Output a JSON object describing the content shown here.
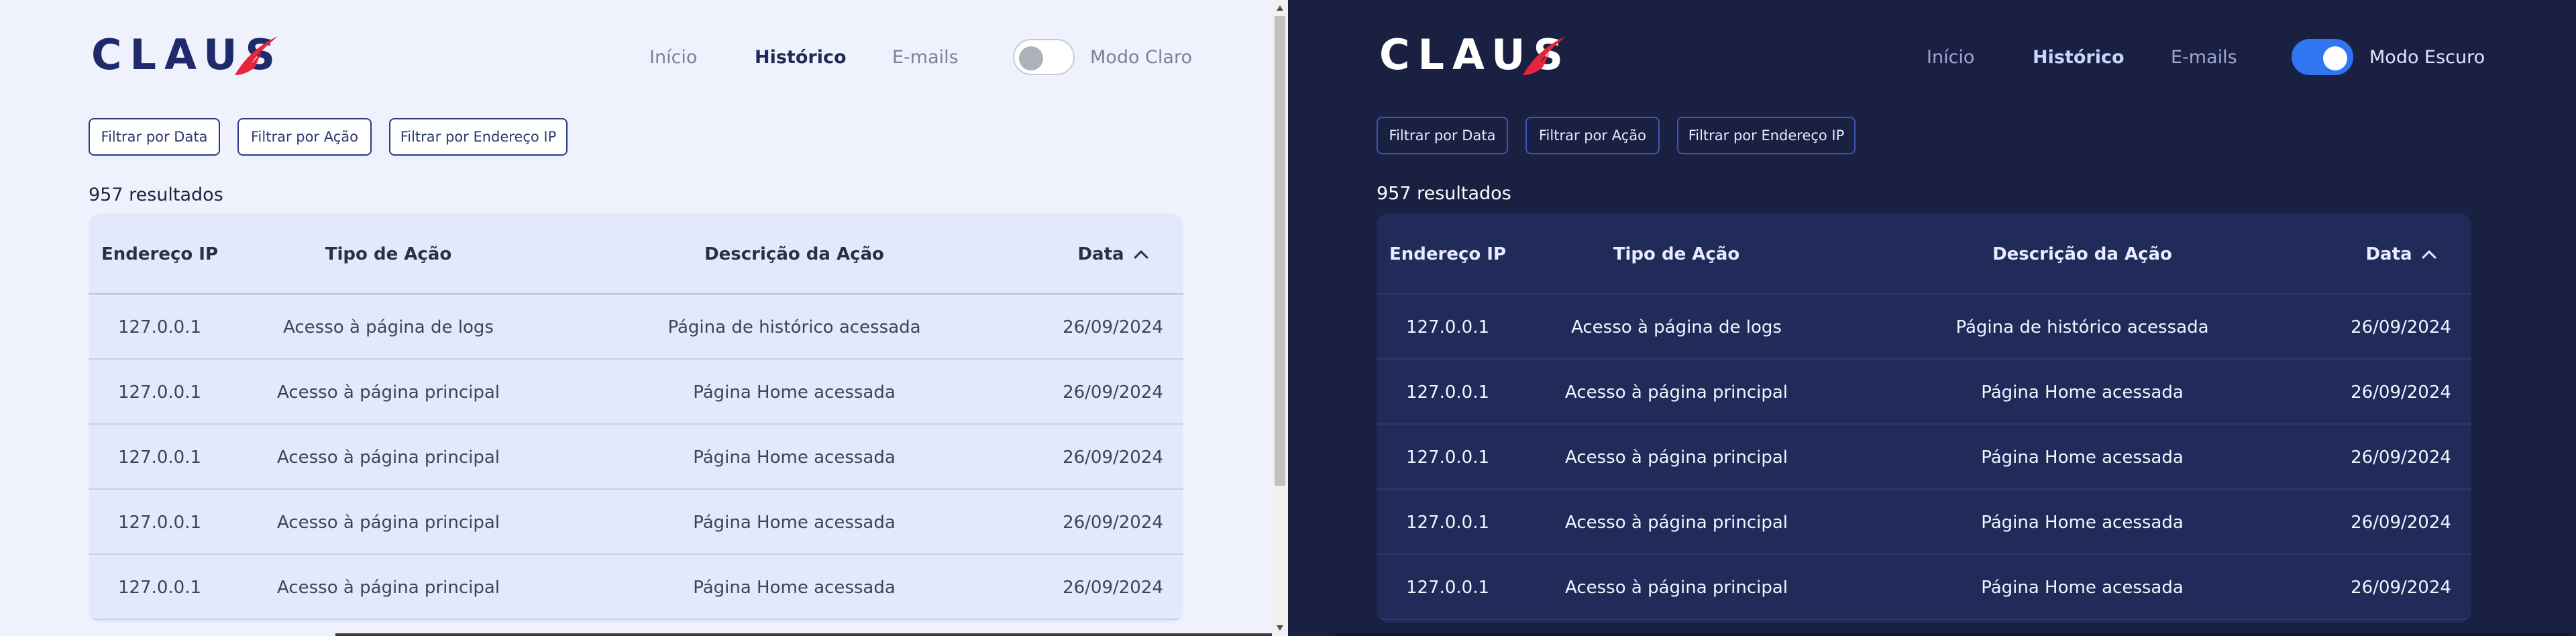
{
  "brand": {
    "logo_text": "CLAUS"
  },
  "nav": {
    "inicio": "Início",
    "historico": "Histórico",
    "emails": "E-mails"
  },
  "light": {
    "mode_label": "Modo Claro"
  },
  "dark": {
    "mode_label": "Modo Escuro"
  },
  "filters": {
    "by_date": "Filtrar por Data",
    "by_action": "Filtrar por Ação",
    "by_ip": "Filtrar por Endereço IP"
  },
  "results_count": "957 resultados",
  "table": {
    "headers": {
      "ip": "Endereço IP",
      "tipo": "Tipo de Ação",
      "desc": "Descrição da Ação",
      "data": "Data"
    },
    "sort": {
      "column": "Data",
      "direction": "ascending"
    },
    "rows": [
      {
        "ip": "127.0.0.1",
        "tipo": "Acesso à página de logs",
        "desc": "Página de histórico acessada",
        "data": "26/09/2024"
      },
      {
        "ip": "127.0.0.1",
        "tipo": "Acesso à página principal",
        "desc": "Página Home acessada",
        "data": "26/09/2024"
      },
      {
        "ip": "127.0.0.1",
        "tipo": "Acesso à página principal",
        "desc": "Página Home acessada",
        "data": "26/09/2024"
      },
      {
        "ip": "127.0.0.1",
        "tipo": "Acesso à página principal",
        "desc": "Página Home acessada",
        "data": "26/09/2024"
      },
      {
        "ip": "127.0.0.1",
        "tipo": "Acesso à página principal",
        "desc": "Página Home acessada",
        "data": "26/09/2024"
      }
    ]
  },
  "colors": {
    "light_bg": "#eff2fd",
    "dark_bg": "#1a2042",
    "brand_navy": "#1e2a6a",
    "brand_red": "#e8243c",
    "toggle_on": "#2f76f0"
  }
}
